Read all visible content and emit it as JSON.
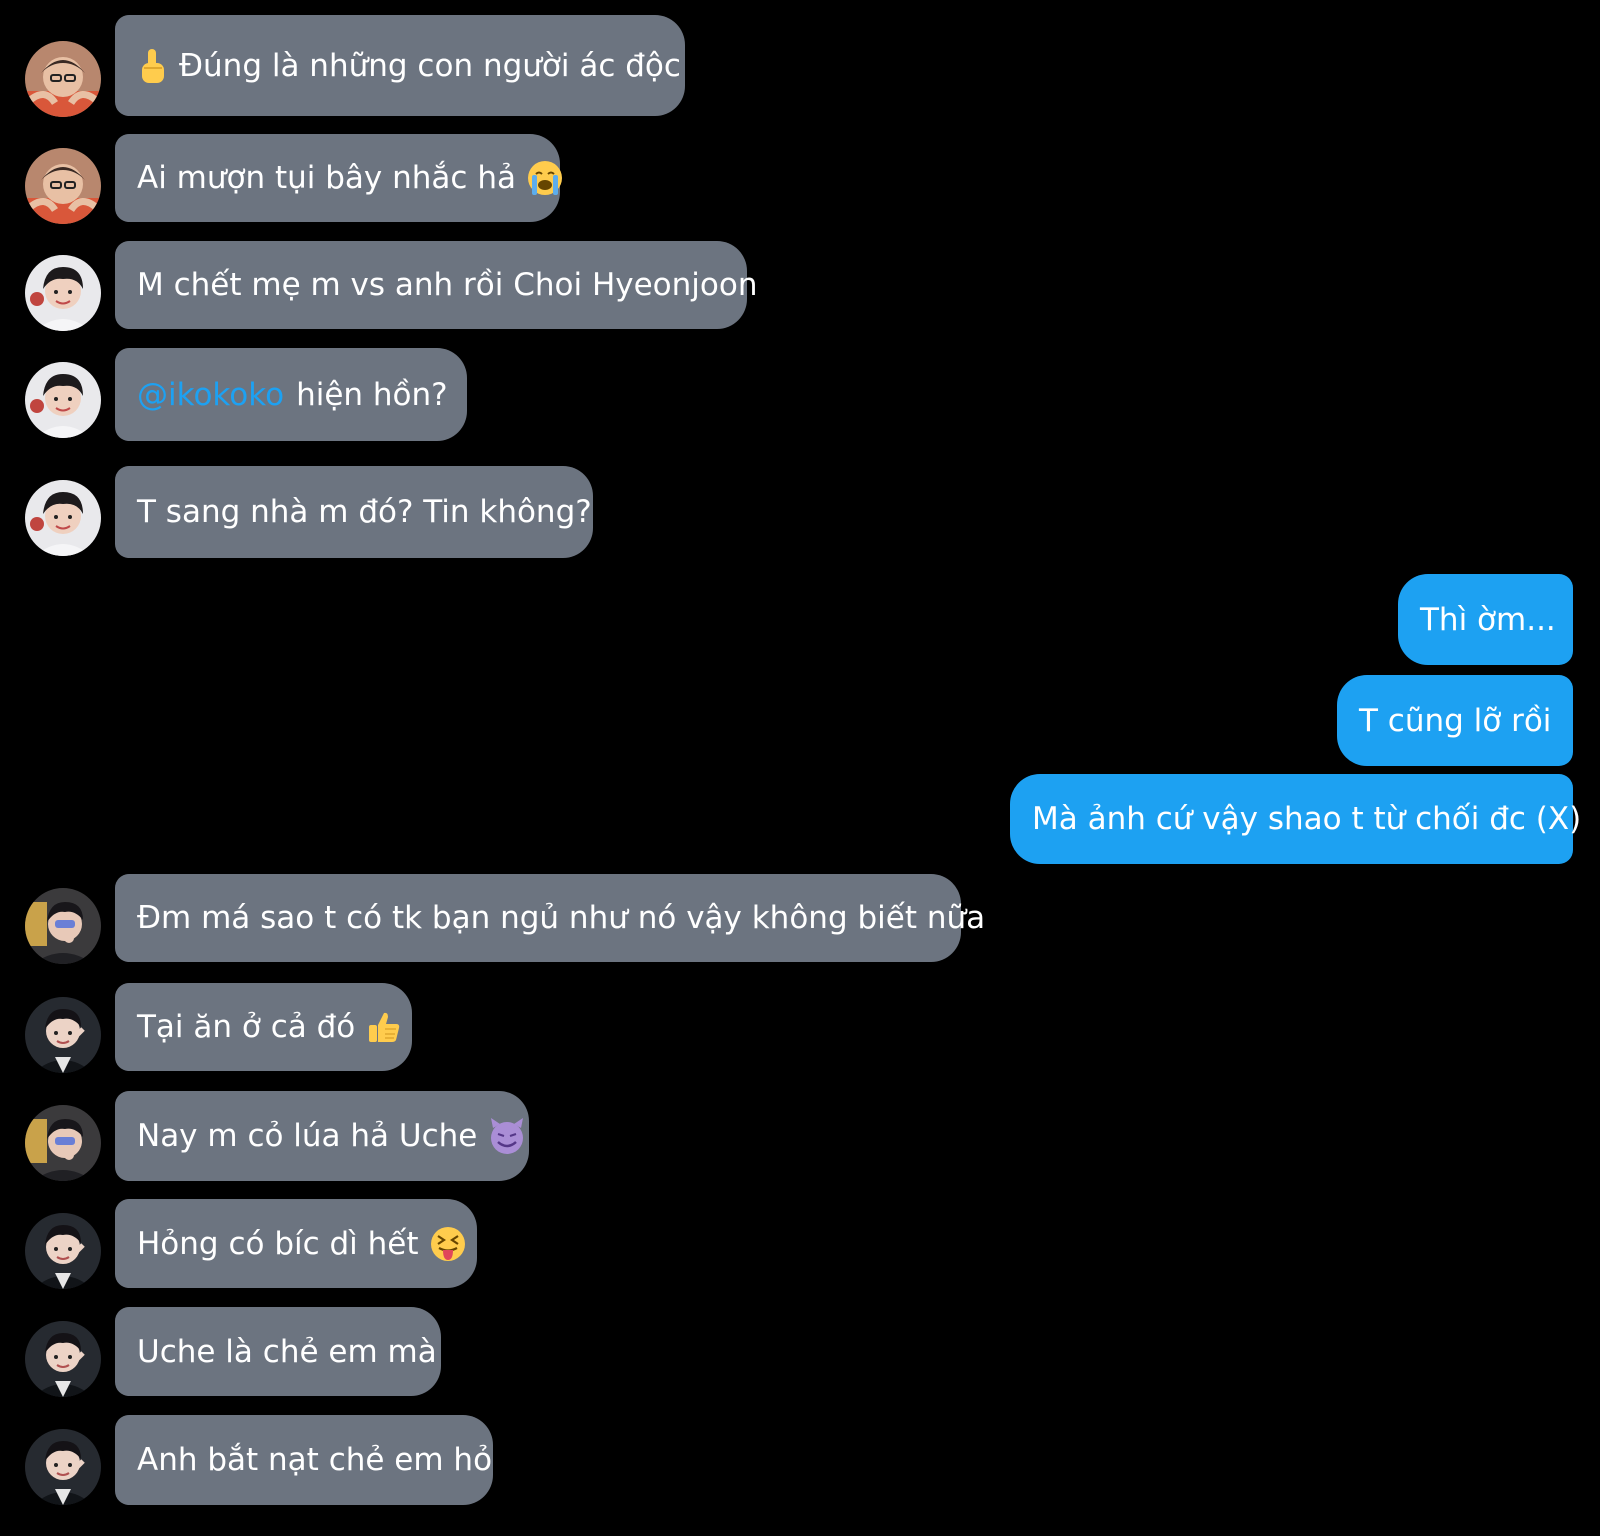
{
  "messages": [
    {
      "side": "in",
      "avatar": "avatar-red-heart",
      "emoji_lead": "☝",
      "text": "Đúng là những con người ác độc"
    },
    {
      "side": "in",
      "avatar": "avatar-red-heart",
      "text": "Ai mượn tụi bây nhắc hả",
      "emoji": "😭"
    },
    {
      "side": "in",
      "avatar": "avatar-white-shirt",
      "text": "M chết mẹ m vs anh rồi Choi Hyeonjoon"
    },
    {
      "side": "in",
      "avatar": "avatar-white-shirt",
      "mention": "@ikokoko",
      "text": "hiện hồn?"
    },
    {
      "side": "in",
      "avatar": "avatar-white-shirt",
      "text": "T sang nhà m đó? Tin không?"
    },
    {
      "side": "out",
      "text": "Thì ờm..."
    },
    {
      "side": "out",
      "text": "T cũng lỡ rồi"
    },
    {
      "side": "out",
      "text": "Mà ảnh cứ vậy shao t từ chối đc (X)"
    },
    {
      "side": "in",
      "avatar": "avatar-gaming-chair",
      "text": "Đm má sao t có tk bạn ngủ như nó vậy không biết nữa"
    },
    {
      "side": "in",
      "avatar": "avatar-dark-jacket",
      "text": "Tại ăn ở cả đó",
      "emoji": "👍"
    },
    {
      "side": "in",
      "avatar": "avatar-gaming-chair",
      "text": "Nay m cỏ lúa hả Uche",
      "emoji": "😈"
    },
    {
      "side": "in",
      "avatar": "avatar-dark-jacket",
      "text": "Hỏng có bíc dì hết",
      "emoji": "😝"
    },
    {
      "side": "in",
      "avatar": "avatar-dark-jacket",
      "text": "Uche là chẻ em mà"
    },
    {
      "side": "in",
      "avatar": "avatar-dark-jacket",
      "text": "Anh bắt nạt chẻ em hỏ"
    }
  ],
  "colors": {
    "background": "#000000",
    "incoming_bubble": "#6c7480",
    "outgoing_bubble": "#1da1f2",
    "mention": "#1da1f2",
    "text": "#ffffff"
  }
}
